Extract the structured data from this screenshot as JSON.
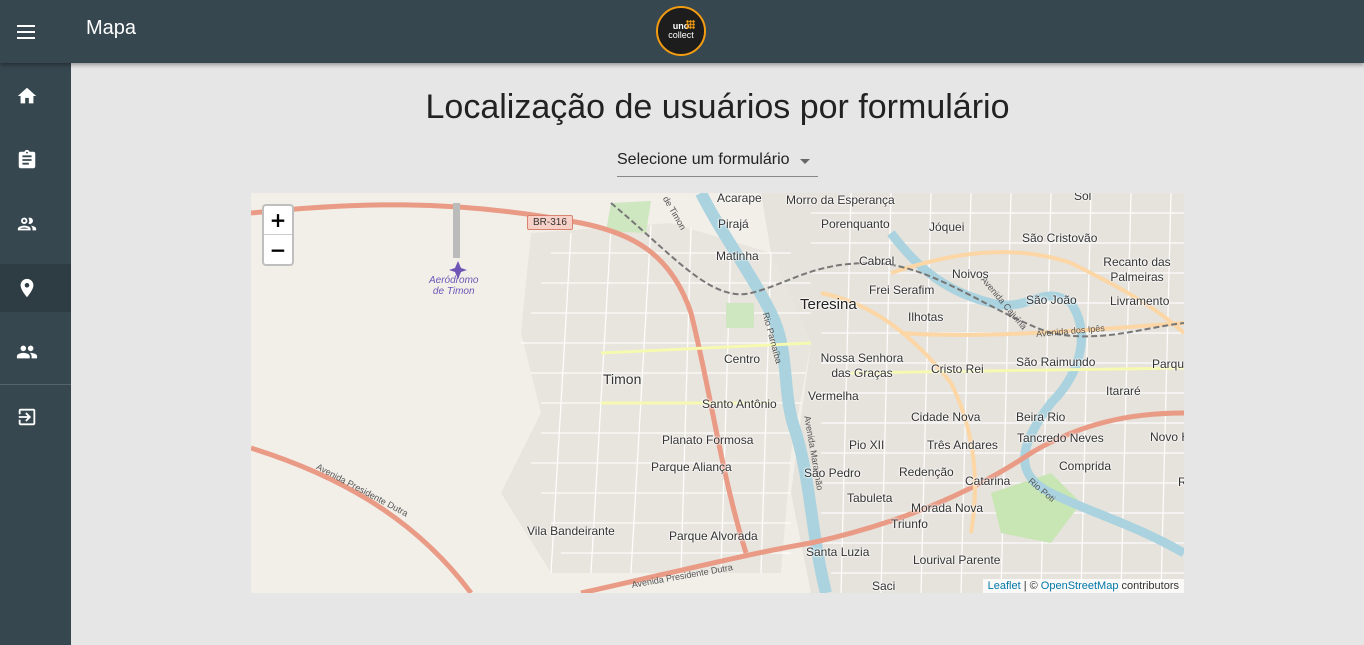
{
  "header": {
    "title": "Mapa",
    "logo_line1": "uno",
    "logo_line2": "collect",
    "menu_icon": "menu-icon"
  },
  "sidebar": {
    "items": [
      {
        "icon": "home-icon",
        "name": "home"
      },
      {
        "icon": "clipboard-icon",
        "name": "forms"
      },
      {
        "icon": "user-group-icon",
        "name": "users"
      },
      {
        "icon": "location-pin-icon",
        "name": "map",
        "active": true
      },
      {
        "icon": "people-icon",
        "name": "teams"
      },
      {
        "icon": "logout-icon",
        "name": "logout"
      }
    ]
  },
  "main": {
    "heading": "Localização de usuários por formulário",
    "select": {
      "value": "Selecione um formulário"
    }
  },
  "map": {
    "zoom_in": "+",
    "zoom_out": "−",
    "attribution": {
      "leaflet": "Leaflet",
      "separator": "| ©",
      "osm": "OpenStreetMap",
      "suffix": "contributors"
    },
    "shield": "BR-316",
    "airport": {
      "line1": "Aeródromo",
      "line2": "de Timon"
    },
    "roads": {
      "dutra_west": "Avenida Presidente Dutra",
      "dutra_south": "Avenida Presidente Dutra",
      "ipes": "Avenida dos Ipês",
      "cajuina": "Avenida Cajuína",
      "rio_poti": "Rio Poti",
      "parnaiba": "Rio Parnaíba",
      "maranhao": "Avenida Maranhão",
      "timon": "de Timon"
    },
    "labels": {
      "teresina": "Teresina",
      "timon": "Timon",
      "acarape": "Acarape",
      "morro": "Morro da Esperança",
      "sol": "Sol",
      "piraja": "Pirajá",
      "porenquanto": "Porenquanto",
      "joquei": "Jóquei",
      "sao_cristovao": "São Cristovão",
      "matinha": "Matinha",
      "cabral": "Cabral",
      "noivos": "Noivos",
      "recanto": "Recanto das Palmeiras",
      "frei": "Frei Serafim",
      "sao_joao": "São João",
      "livramento": "Livramento",
      "ilhotas": "Ilhotas",
      "centro": "Centro",
      "nossa": "Nossa Senhora das Graças",
      "sao_raimundo": "São Raimundo",
      "parque": "Parque",
      "cristo": "Cristo Rei",
      "itarare": "Itararé",
      "santo_antonio": "Santo Antônio",
      "vermelha": "Vermelha",
      "cidade_nova": "Cidade Nova",
      "beira_rio": "Beira Rio",
      "tancredo": "Tancredo Neves",
      "novo_ho": "Novo Ho",
      "planato": "Planato Formosa",
      "pio": "Pio XII",
      "tres_andares": "Três Andares",
      "parque_alianca": "Parque Aliança",
      "sao_pedro": "São Pedro",
      "redencao": "Redenção",
      "compreda": "Comprida",
      "r": "R",
      "catarina": "Catarina",
      "tabuleta": "Tabuleta",
      "morada": "Morada Nova",
      "vila": "Vila Bandeirante",
      "triunfo": "Triunfo",
      "parque_alvorada": "Parque Alvorada",
      "santa_luzia": "Santa Luzia",
      "lourival": "Lourival Parente",
      "saci": "Saci"
    }
  }
}
